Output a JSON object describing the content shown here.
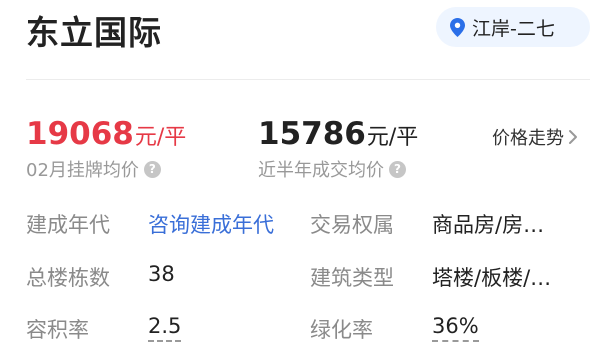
{
  "header": {
    "title": "东立国际",
    "location": "江岸-二七"
  },
  "prices": {
    "listing": {
      "value": "19068",
      "unit": "元/平",
      "caption": "02月挂牌均价"
    },
    "transaction": {
      "value": "15786",
      "unit": "元/平",
      "caption": "近半年成交均价"
    },
    "trend_link": "价格走势",
    "help_glyph": "?"
  },
  "info": {
    "build_year_label": "建成年代",
    "build_year_value": "咨询建成年代",
    "ownership_label": "交易权属",
    "ownership_value": "商品房/房…",
    "buildings_label": "总楼栋数",
    "buildings_value": "38",
    "building_type_label": "建筑类型",
    "building_type_value": "塔楼/板楼/…",
    "plot_ratio_label": "容积率",
    "plot_ratio_value": "2.5",
    "green_ratio_label": "绿化率",
    "green_ratio_value": "36%"
  },
  "colors": {
    "accent_red": "#e63946",
    "link_blue": "#3a6fd8",
    "chip_bg": "#eef5ff"
  },
  "icons": {
    "location": "location-pin-icon",
    "help": "help-circle-icon",
    "trend": "chevron-right-icon"
  }
}
